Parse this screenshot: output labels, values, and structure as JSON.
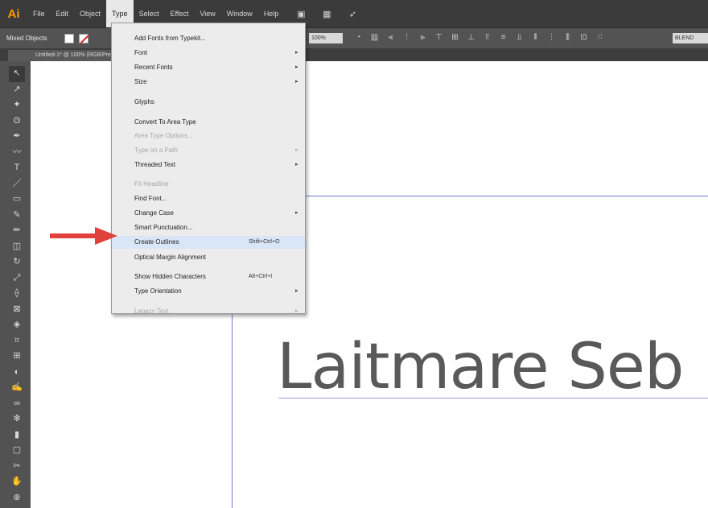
{
  "app": {
    "logo": "Ai"
  },
  "menubar": {
    "items": [
      "File",
      "Edit",
      "Object",
      "Type",
      "Select",
      "Effect",
      "View",
      "Window",
      "Help"
    ],
    "active": "Type"
  },
  "controlbar": {
    "selection_label": "Mixed Objects",
    "opacity_value": "100%",
    "field_value": "BLEND"
  },
  "document_tab": {
    "label": "Untitled-1* @ 100% (RGB/Preview)"
  },
  "type_menu": {
    "items": [
      {
        "label": "Add Fonts from Typekit...",
        "shortcut": "",
        "submenu": false,
        "enabled": true
      },
      {
        "label": "Font",
        "shortcut": "",
        "submenu": true,
        "enabled": true
      },
      {
        "label": "Recent Fonts",
        "shortcut": "",
        "submenu": true,
        "enabled": true
      },
      {
        "label": "Size",
        "shortcut": "",
        "submenu": true,
        "enabled": true
      },
      {
        "label": "Glyphs",
        "shortcut": "",
        "submenu": false,
        "enabled": true
      },
      {
        "label": "Convert To Area Type",
        "shortcut": "",
        "submenu": false,
        "enabled": true
      },
      {
        "label": "Area Type Options...",
        "shortcut": "",
        "submenu": false,
        "enabled": false
      },
      {
        "label": "Type on a Path",
        "shortcut": "",
        "submenu": true,
        "enabled": false
      },
      {
        "label": "Threaded Text",
        "shortcut": "",
        "submenu": true,
        "enabled": true
      },
      {
        "label": "Fit Headline",
        "shortcut": "",
        "submenu": false,
        "enabled": false
      },
      {
        "label": "Find Font...",
        "shortcut": "",
        "submenu": false,
        "enabled": true
      },
      {
        "label": "Change Case",
        "shortcut": "",
        "submenu": true,
        "enabled": true
      },
      {
        "label": "Smart Punctuation...",
        "shortcut": "",
        "submenu": false,
        "enabled": true
      },
      {
        "label": "Create Outlines",
        "shortcut": "Shift+Ctrl+O",
        "submenu": false,
        "enabled": true,
        "highlighted": true
      },
      {
        "label": "Optical Margin Alignment",
        "shortcut": "",
        "submenu": false,
        "enabled": true
      },
      {
        "label": "Show Hidden Characters",
        "shortcut": "Alt+Ctrl+I",
        "submenu": false,
        "enabled": true
      },
      {
        "label": "Type Orientation",
        "shortcut": "",
        "submenu": true,
        "enabled": true
      },
      {
        "label": "Legacy Text",
        "shortcut": "",
        "submenu": true,
        "enabled": false
      }
    ]
  },
  "canvas": {
    "text": "Laitmare Seb"
  },
  "colors": {
    "menubar": "#3b3b3b",
    "panel": "#525252",
    "accent_logo": "#ff9a00",
    "guide": "#6f78d6",
    "arrow": "#e0413a",
    "text": "#595959"
  },
  "tools": [
    "selection-tool",
    "direct-selection-tool",
    "magic-wand-tool",
    "lasso-tool",
    "pen-tool",
    "curvature-tool",
    "type-tool",
    "line-segment-tool",
    "rectangle-tool",
    "paintbrush-tool",
    "pencil-tool",
    "eraser-tool",
    "rotate-tool",
    "scale-tool",
    "width-tool",
    "free-transform-tool",
    "shape-builder-tool",
    "perspective-grid-tool",
    "mesh-tool",
    "gradient-tool",
    "eyedropper-tool",
    "blend-tool",
    "symbol-sprayer-tool",
    "column-graph-tool",
    "artboard-tool",
    "slice-tool",
    "hand-tool",
    "zoom-tool"
  ]
}
